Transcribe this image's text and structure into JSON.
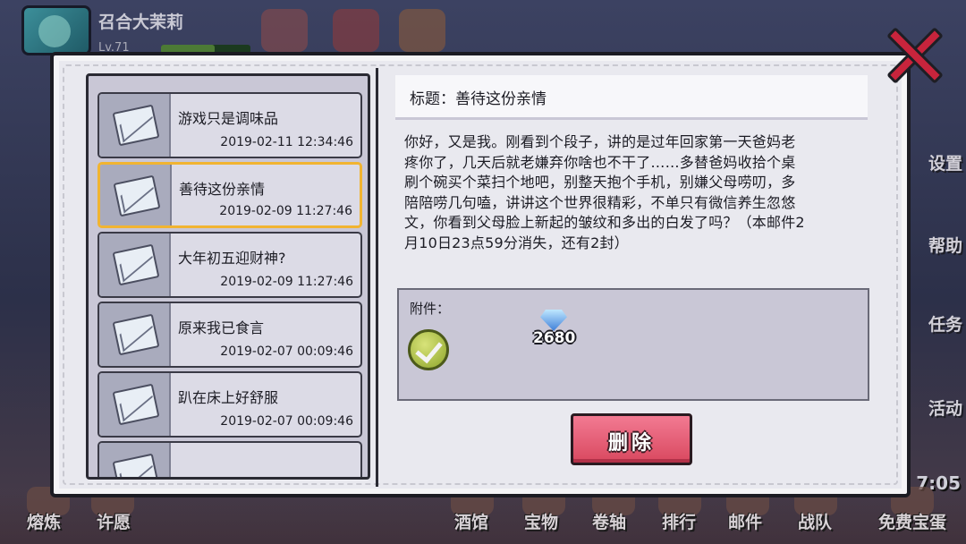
{
  "hud": {
    "player_name": "召合大茉莉",
    "level": "Lv.71",
    "exp_fraction": 0.6,
    "clock": "7:05"
  },
  "side_menu": [
    "设置",
    "帮助",
    "任务",
    "活动"
  ],
  "bottom_nav": [
    "熔炼",
    "许愿",
    "酒馆",
    "宝物",
    "卷轴",
    "排行",
    "邮件",
    "战队",
    "免费宝蛋"
  ],
  "mail_list": [
    {
      "title": "游戏只是调味品",
      "date": "2019-02-11 12:34:46",
      "selected": false
    },
    {
      "title": "善待这份亲情",
      "date": "2019-02-09 11:27:46",
      "selected": true
    },
    {
      "title": "大年初五迎财神?",
      "date": "2019-02-09 11:27:46",
      "selected": false
    },
    {
      "title": "原来我已食言",
      "date": "2019-02-07 00:09:46",
      "selected": false
    },
    {
      "title": "趴在床上好舒服",
      "date": "2019-02-07 00:09:46",
      "selected": false
    },
    {
      "title": "",
      "date": "",
      "selected": false
    }
  ],
  "detail": {
    "title": "标题：善待这份亲情",
    "body_lines": [
      "你好，又是我。刚看到个段子，讲的是过年回家第一天爸妈老",
      "疼你了，几天后就老嫌弃你啥也不干了……多替爸妈收拾个桌",
      "刷个碗买个菜扫个地吧，别整天抱个手机，别嫌父母唠叨，多",
      "陪陪唠几句嗑，讲讲这个世界很精彩，不单只有微信养生忽悠",
      "文，你看到父母脸上新起的皱纹和多出的白发了吗？（本邮件2",
      "月10日23点59分消失，还有2封）"
    ],
    "attachment_label": "附件：",
    "attachment_gem_count": "2680",
    "delete_label": "删除"
  },
  "colors": {
    "dialog_bg": "#e9e9ef",
    "list_bg": "#c9c7d6",
    "selected_border": "#f1b431",
    "delete_button": "#d9485f",
    "close_x": "#c8243c"
  }
}
